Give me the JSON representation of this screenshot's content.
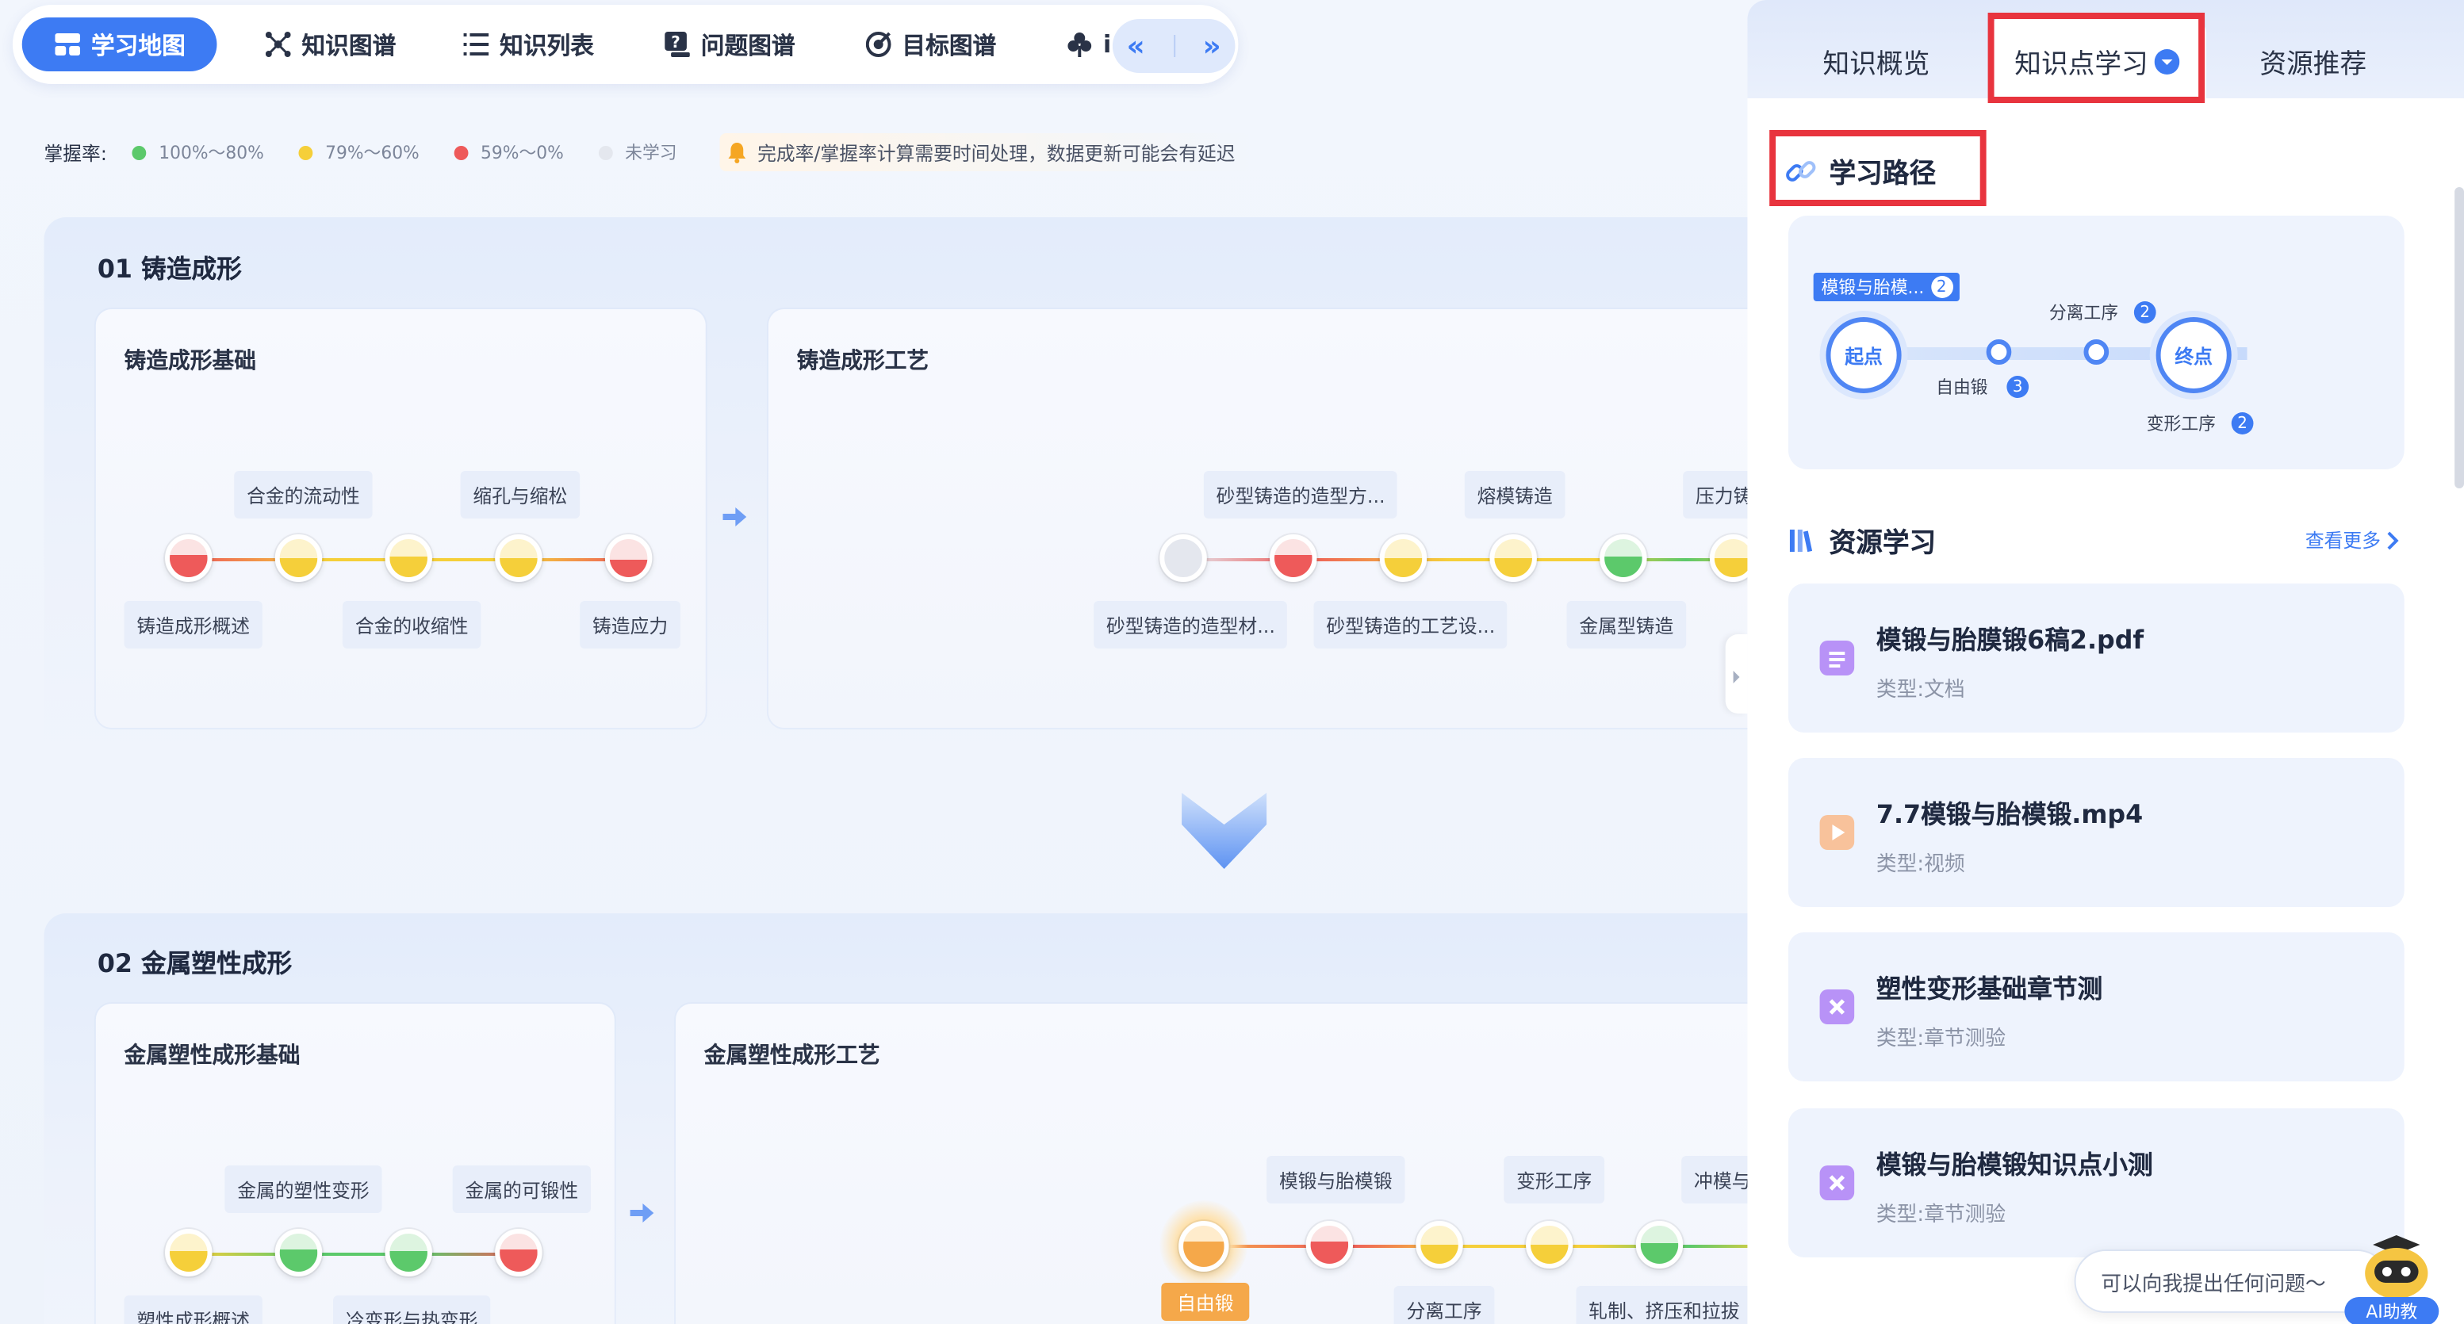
{
  "nav": {
    "tabs": [
      {
        "label": "学习地图",
        "icon": "map-icon",
        "active": true
      },
      {
        "label": "知识图谱",
        "icon": "graph-icon"
      },
      {
        "label": "知识列表",
        "icon": "list-icon"
      },
      {
        "label": "问题图谱",
        "icon": "question-icon"
      },
      {
        "label": "目标图谱",
        "icon": "target-icon"
      },
      {
        "label": "i",
        "icon": "club-icon"
      }
    ],
    "prev": "«",
    "next": "»"
  },
  "legend": {
    "label": "掌握率:",
    "items": [
      {
        "text": "100%～80%",
        "color": "#5cc96b"
      },
      {
        "text": "79%～60%",
        "color": "#f5cf3a"
      },
      {
        "text": "59%～0%",
        "color": "#ee5a5a"
      },
      {
        "text": "未学习",
        "color": "#e4e7ee"
      }
    ],
    "notice": "完成率/掌握率计算需要时间处理，数据更新可能会有延迟"
  },
  "sections": [
    {
      "title": "01 铸造成形",
      "cards": [
        {
          "title": "铸造成形基础",
          "upper": [
            "合金的流动性",
            "缩孔与缩松"
          ],
          "lower": [
            "铸造成形概述",
            "合金的收缩性",
            "铸造应力"
          ]
        },
        {
          "title": "铸造成形工艺",
          "upper": [
            "砂型铸造的造型方...",
            "熔模铸造",
            "压力铸"
          ],
          "lower": [
            "砂型铸造的造型材...",
            "砂型铸造的工艺设...",
            "金属型铸造"
          ]
        }
      ]
    },
    {
      "title": "02 金属塑性成形",
      "cards": [
        {
          "title": "金属塑性成形基础",
          "upper": [
            "金属的塑性变形",
            "金属的可锻性"
          ],
          "lower": [
            "塑性成形概述",
            "冷变形与热变形"
          ]
        },
        {
          "title": "金属塑性成形工艺",
          "upper": [
            "模锻与胎模锻",
            "变形工序",
            "冲模与"
          ],
          "lower": [
            "自由锻",
            "分离工序",
            "轧制、挤压和拉拔"
          ]
        }
      ]
    }
  ],
  "panel": {
    "tabs": [
      "知识概览",
      "知识点学习",
      "资源推荐"
    ],
    "path": {
      "title": "学习路径",
      "start": "起点",
      "end": "终点",
      "current": {
        "label": "模锻与胎模...",
        "count": "2"
      },
      "steps": [
        {
          "label": "自由锻",
          "count": "3"
        },
        {
          "label": "分离工序",
          "count": "2"
        },
        {
          "label": "变形工序",
          "count": "2"
        }
      ]
    },
    "resources": {
      "title": "资源学习",
      "more": "查看更多",
      "items": [
        {
          "title": "模锻与胎膜锻6稿2.pdf",
          "type": "类型:文档",
          "icon": "document-icon",
          "color": "#9b6cf0"
        },
        {
          "title": "7.7模锻与胎模锻.mp4",
          "type": "类型:视频",
          "icon": "video-icon",
          "color": "#f4a36a"
        },
        {
          "title": "塑性变形基础章节测",
          "type": "类型:章节测验",
          "icon": "quiz-icon",
          "color": "#9b6cf0"
        },
        {
          "title": "模锻与胎模锻知识点小测",
          "type": "类型:章节测验",
          "icon": "quiz-icon",
          "color": "#9b6cf0"
        }
      ]
    },
    "assistant": {
      "placeholder": "可以向我提出任何问题～",
      "badge": "AI助教"
    }
  }
}
